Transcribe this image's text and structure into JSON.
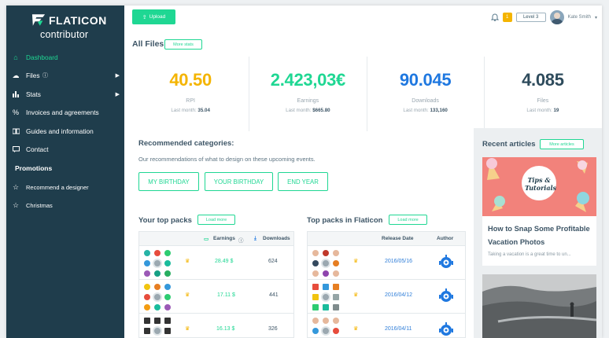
{
  "brand": {
    "name": "FLATICON",
    "sub": "contributor"
  },
  "nav": [
    {
      "label": "Dashboard",
      "icon": "home-icon",
      "active": true,
      "arrow": false
    },
    {
      "label": "Files",
      "icon": "cloud-icon",
      "info": true,
      "arrow": true
    },
    {
      "label": "Stats",
      "icon": "chart-icon",
      "arrow": true
    },
    {
      "label": "Invoices and agreements",
      "icon": "percent-icon",
      "arrow": false
    },
    {
      "label": "Guides and information",
      "icon": "book-icon",
      "arrow": false
    },
    {
      "label": "Contact",
      "icon": "chat-icon",
      "arrow": false
    }
  ],
  "promotions": {
    "title": "Promotions",
    "items": [
      {
        "label": "Recommend a designer"
      },
      {
        "label": "Christmas"
      }
    ]
  },
  "header": {
    "upload": "Upload",
    "badge": "1",
    "level": "Level 3",
    "user": "Kate Smith"
  },
  "allfiles": {
    "title": "All Files",
    "more": "More stats"
  },
  "stats": [
    {
      "value": "40.50",
      "label": "RPI",
      "lm_label": "Last month:",
      "lm_value": "35.04",
      "color": "#f4b400"
    },
    {
      "value": "2.423,03€",
      "label": "Earnings",
      "lm_label": "Last month:",
      "lm_value": "$665.80",
      "color": "#1fd793"
    },
    {
      "value": "90.045",
      "label": "Downloads",
      "lm_label": "Last month:",
      "lm_value": "133,160",
      "color": "#1f78e0"
    },
    {
      "value": "4.085",
      "label": "Files",
      "lm_label": "Last month:",
      "lm_value": "19",
      "color": "#2e4b5c"
    }
  ],
  "recommended": {
    "title": "Recommended categories:",
    "desc": "Our recommendations of what to design on these upcoming events.",
    "cats": [
      "MY BIRTHDAY",
      "YOUR BIRTHDAY",
      "END YEAR"
    ]
  },
  "recent": {
    "title": "Recent articles",
    "more": "More articles",
    "a1_title": "How to Snap Some Profitable Vacation Photos",
    "a1_excerpt": "Taking a vacation is a great time to un...",
    "img1_text": "Tips & Tutorials"
  },
  "top_packs": {
    "title": "Your top packs",
    "more": "Load more",
    "col_earnings": "Earnings",
    "col_downloads": "Downloads",
    "rows": [
      {
        "earnings": "28.49 $",
        "downloads": "624"
      },
      {
        "earnings": "17.11 $",
        "downloads": "441"
      },
      {
        "earnings": "16.13 $",
        "downloads": "326"
      }
    ]
  },
  "top_flaticon": {
    "title": "Top packs in Flaticon",
    "more": "Load more",
    "col_date": "Release Date",
    "col_author": "Author",
    "rows": [
      {
        "date": "2016/05/16"
      },
      {
        "date": "2016/04/12"
      },
      {
        "date": "2016/04/11"
      }
    ]
  }
}
